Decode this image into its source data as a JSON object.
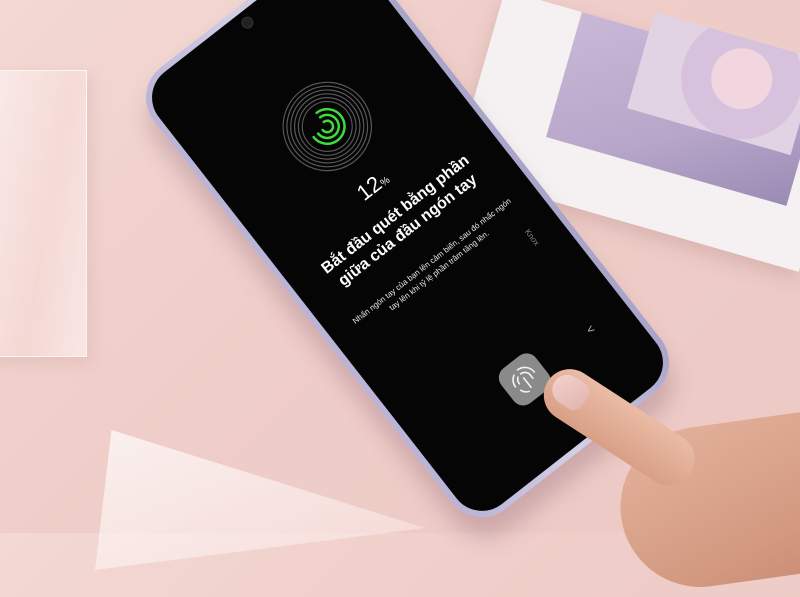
{
  "screen": {
    "progress_percent": 12,
    "percent_number": "12",
    "percent_sign": "%",
    "title": "Bắt đầu quét bằng phần giữa của đầu ngón tay",
    "description": "Nhấn ngón tay của bạn lên cảm biến, sau đó nhấc ngón tay lên khi tỷ lệ phần trăm tăng lên.",
    "brand_label": "Knox",
    "back_symbol": "<"
  },
  "colors": {
    "fingerprint_active": "#3ddc3a",
    "fingerprint_inactive": "#5a5a5a",
    "background": "#f0d0cb"
  },
  "icons": [
    "fingerprint-icon",
    "fingerprint-sensor-icon",
    "back-icon"
  ]
}
